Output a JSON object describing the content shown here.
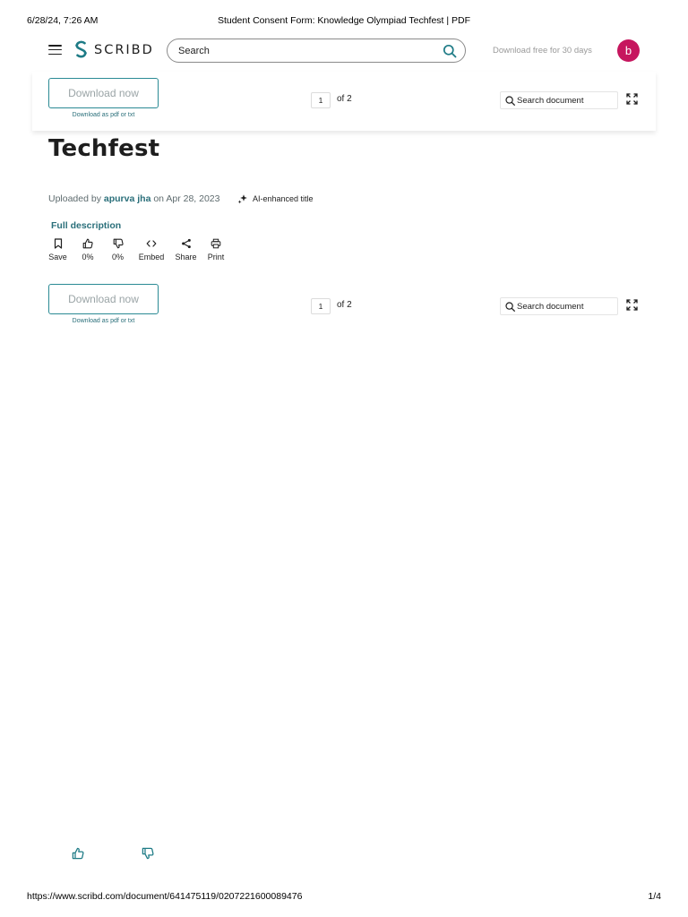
{
  "print_header": {
    "date": "6/28/24, 7:26 AM",
    "title": "Student Consent Form: Knowledge Olympiad Techfest | PDF"
  },
  "nav": {
    "logo_text": "SCRIBD",
    "search_placeholder": "Search",
    "trial_link": "Download free for 30 days",
    "avatar_letter": "b",
    "avatar_color": "#c6165e"
  },
  "toolbar": {
    "download_label": "Download now",
    "download_sub": "Download as pdf or txt",
    "page_value": "1",
    "page_total": "of 2",
    "doc_search_placeholder": "Search document"
  },
  "document": {
    "title_visible": "Techfest",
    "uploaded_prefix": "Uploaded by",
    "author": "apurva jha",
    "date_text": "on Apr 28, 2023",
    "ai_badge": "AI-enhanced title",
    "full_description": "Full description"
  },
  "actions": [
    {
      "icon": "bookmark-icon",
      "label": "Save"
    },
    {
      "icon": "thumbs-up-icon",
      "label": "0%"
    },
    {
      "icon": "thumbs-down-icon",
      "label": "0%"
    },
    {
      "icon": "embed-icon",
      "label": "Embed"
    },
    {
      "icon": "share-icon",
      "label": "Share"
    },
    {
      "icon": "print-icon",
      "label": "Print"
    }
  ],
  "print_footer": {
    "url": "https://www.scribd.com/document/641475119/0207221600089476",
    "page": "1/4"
  },
  "colors": {
    "accent": "#2a8a94",
    "link": "#2a6f7a",
    "muted": "#9aa4a6"
  }
}
